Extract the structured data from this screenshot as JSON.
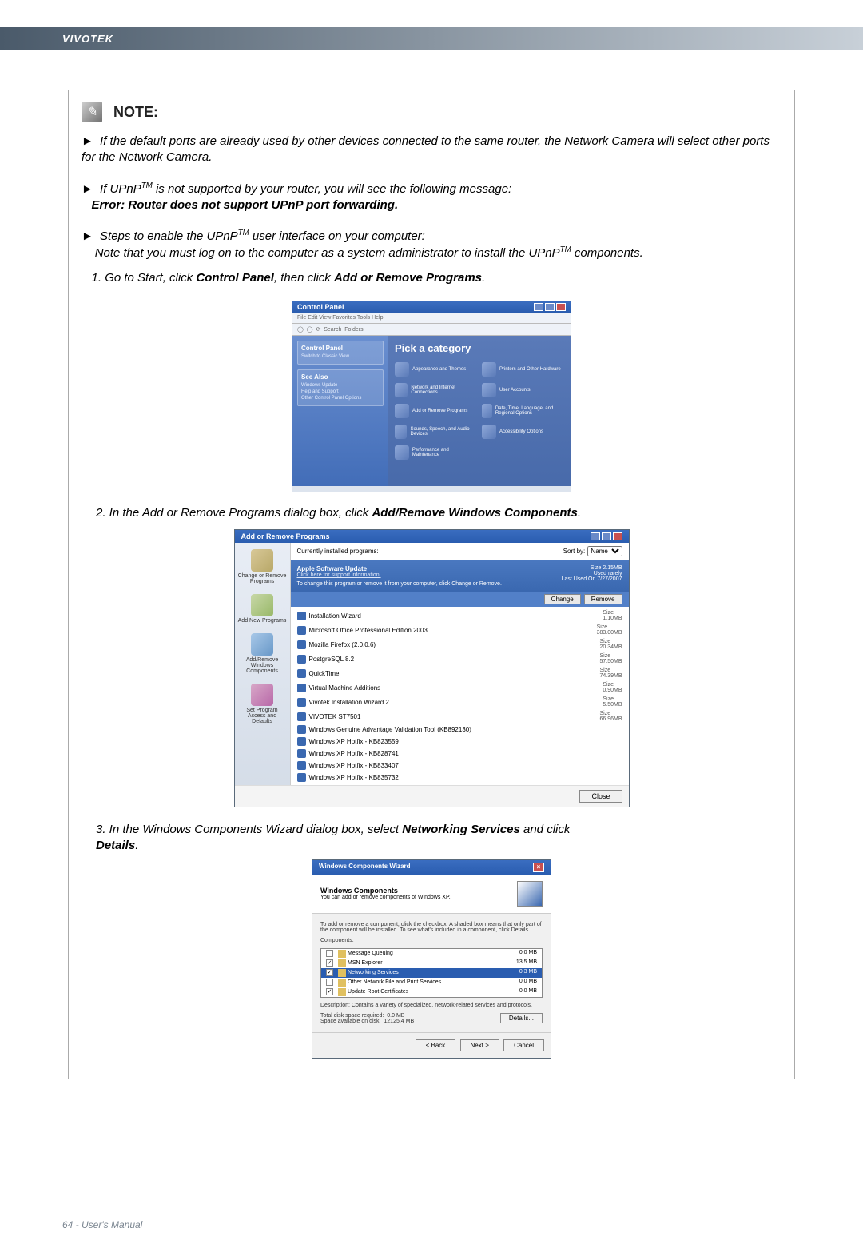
{
  "brand": "VIVOTEK",
  "note_title": "NOTE:",
  "note_icon_glyph": "✎",
  "notes": {
    "n1": "If the default ports are already used by other devices connected to the same router, the Network Camera will select other ports for the Network Camera.",
    "n2_prefix": "If UPnP",
    "n2_suffix": " is not supported by your router, you will see the following message:",
    "n2_error": "Error: Router does not support UPnP port forwarding.",
    "n3_prefix": "Steps to enable the UPnP",
    "n3_mid": " user interface on your computer:",
    "n3_line2a": "Note that you must log on to the computer as a system administrator to install the UPnP",
    "n3_line2b": " components.",
    "step1_a": "1. Go to Start, click ",
    "step1_b": "Control Panel",
    "step1_c": ", then click ",
    "step1_d": "Add or Remove Programs",
    "step1_e": ".",
    "step2_a": "2. In the Add or Remove Programs dialog box, click ",
    "step2_b": "Add/Remove Windows Components",
    "step2_c": ".",
    "step3_a": "3. In the Windows Components Wizard dialog box, select ",
    "step3_b": "Networking Services",
    "step3_c": " and click ",
    "step3_d": "Details",
    "step3_e": "."
  },
  "tm": "TM",
  "control_panel": {
    "title": "Control Panel",
    "menu": "File  Edit  View  Favorites  Tools  Help",
    "side_title1": "Control Panel",
    "side_item1": "Switch to Classic View",
    "side_title2": "See Also",
    "side_items": [
      "Windows Update",
      "Help and Support",
      "Other Control Panel Options"
    ],
    "main_title": "Pick a category",
    "categories": [
      "Appearance and Themes",
      "Printers and Other Hardware",
      "Network and Internet Connections",
      "User Accounts",
      "Add or Remove Programs",
      "Date, Time, Language, and Regional Options",
      "Sounds, Speech, and Audio Devices",
      "Accessibility Options",
      "Performance and Maintenance",
      ""
    ]
  },
  "arp": {
    "title": "Add or Remove Programs",
    "top_label": "Currently installed programs:",
    "sort_label": "Sort by:",
    "sort_value": "Name",
    "side": [
      "Change or Remove Programs",
      "Add New Programs",
      "Add/Remove Windows Components",
      "Set Program Access and Defaults"
    ],
    "selected": {
      "name": "Apple Software Update",
      "support": "Click here for support information.",
      "change_text": "To change this program or remove it from your computer, click Change or Remove.",
      "size_label": "Size",
      "size": "2.15MB",
      "used_label": "Used",
      "used": "rarely",
      "lastused_label": "Last Used On",
      "lastused": "7/27/2007",
      "btn_change": "Change",
      "btn_remove": "Remove"
    },
    "rows": [
      {
        "name": "Installation Wizard",
        "size": "1.10MB"
      },
      {
        "name": "Microsoft Office Professional Edition 2003",
        "size": "383.00MB"
      },
      {
        "name": "Mozilla Firefox (2.0.0.6)",
        "size": "20.34MB"
      },
      {
        "name": "PostgreSQL 8.2",
        "size": "57.50MB"
      },
      {
        "name": "QuickTime",
        "size": "74.39MB"
      },
      {
        "name": "Virtual Machine Additions",
        "size": "0.90MB"
      },
      {
        "name": "Vivotek Installation Wizard 2",
        "size": "5.50MB"
      },
      {
        "name": "VIVOTEK ST7501",
        "size": "66.96MB"
      },
      {
        "name": "Windows Genuine Advantage Validation Tool (KB892130)",
        "size": ""
      },
      {
        "name": "Windows XP Hotfix - KB823559",
        "size": ""
      },
      {
        "name": "Windows XP Hotfix - KB828741",
        "size": ""
      },
      {
        "name": "Windows XP Hotfix - KB833407",
        "size": ""
      },
      {
        "name": "Windows XP Hotfix - KB835732",
        "size": ""
      }
    ],
    "close": "Close"
  },
  "wizard": {
    "title": "Windows Components Wizard",
    "heading": "Windows Components",
    "sub": "You can add or remove components of Windows XP.",
    "desc": "To add or remove a component, click the checkbox. A shaded box means that only part of the component will be installed. To see what's included in a component, click Details.",
    "components_label": "Components:",
    "items": [
      {
        "name": "Message Queuing",
        "size": "0.0 MB",
        "checked": false
      },
      {
        "name": "MSN Explorer",
        "size": "13.5 MB",
        "checked": true
      },
      {
        "name": "Networking Services",
        "size": "0.3 MB",
        "checked": true,
        "selected": true
      },
      {
        "name": "Other Network File and Print Services",
        "size": "0.0 MB",
        "checked": false
      },
      {
        "name": "Update Root Certificates",
        "size": "0.0 MB",
        "checked": true
      }
    ],
    "desc_label": "Description:",
    "desc_text": "Contains a variety of specialized, network-related services and protocols.",
    "total_label": "Total disk space required:",
    "total": "0.0 MB",
    "space_label": "Space available on disk:",
    "space": "12125.4 MB",
    "details_btn": "Details...",
    "back": "< Back",
    "next": "Next >",
    "cancel": "Cancel"
  },
  "footer": "64 - User's Manual"
}
